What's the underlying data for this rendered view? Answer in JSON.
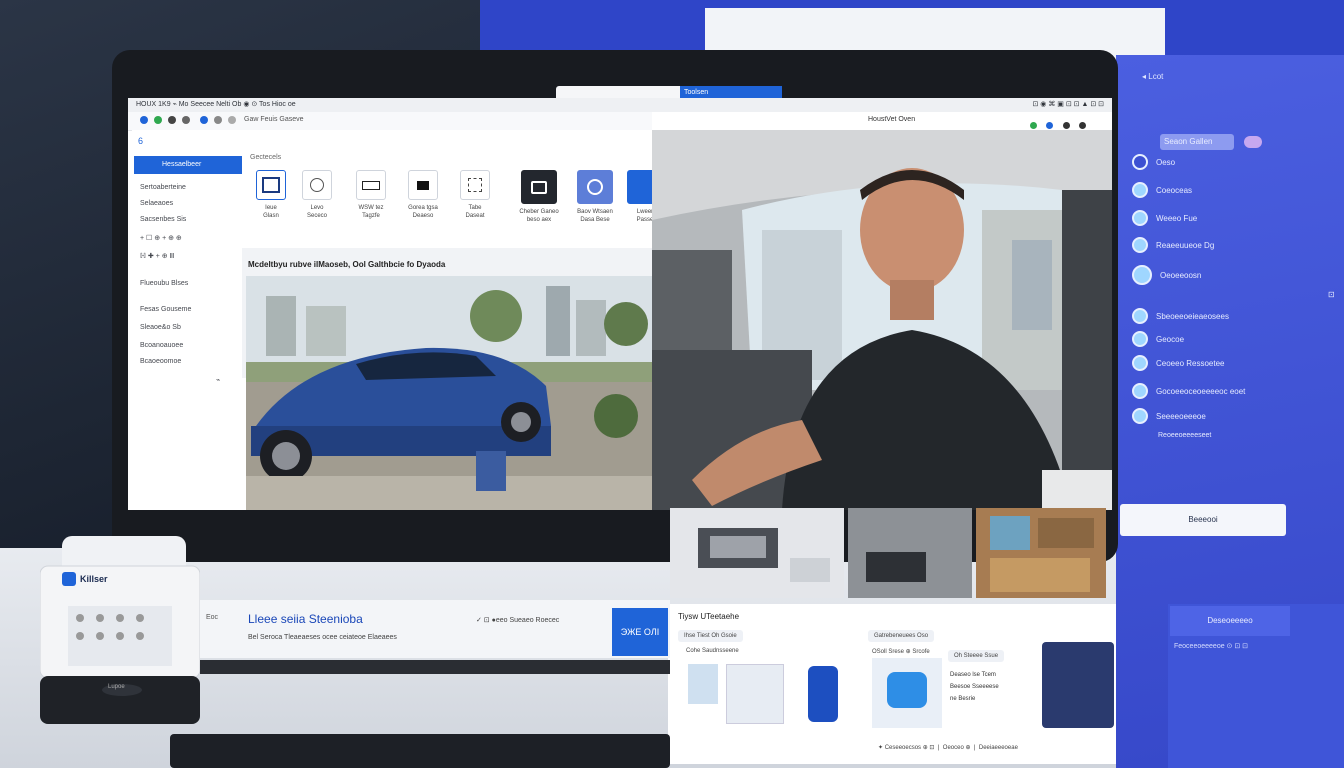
{
  "browser": {
    "menu_left": "HOUX 1K9  ⌁  Mo Seecee Nelti Ob  ◉ ⊙  Tos Hioc oe",
    "menu_right": "⊡ ◉ ⌘ ▣ ⊡ ⊡ ▲ ⊡ ⊡",
    "toolbar_text": "Gaw Feuis Gaseve",
    "active_tab": "Toolsen",
    "video_title": "HoustVet Oven"
  },
  "sidebar": {
    "logo": "6",
    "selected": "Hessaelbeer",
    "items": [
      "Sertoaberteine",
      "Selaeaoes",
      "Sacsenbes Sis",
      "+ ☐ ⊕ + ⊕ ⊕",
      "ℍ ✚ + ⊕ Ⅲ",
      "Flueoubu Blses",
      "Fesas Gouseme",
      "Sleaoe&o Sb",
      "Bcoanoauoee",
      "Bcaoeoomoe"
    ],
    "footer": "⌁"
  },
  "main": {
    "section_label": "Gectecels",
    "tiles": [
      {
        "icon": "frame-icon",
        "label": "Ieue\nGlasn"
      },
      {
        "icon": "clock-icon",
        "label": "Levo\nSececo"
      },
      {
        "icon": "battery-icon",
        "label": "WSW tez\nTagzfe"
      },
      {
        "icon": "screen-icon",
        "label": "Gorea tgsa\nDeaeso"
      },
      {
        "icon": "grid-icon",
        "label": "Tabe\nDaseat"
      },
      {
        "icon": "square-icon",
        "label": "Cheber Ganeo\nbeso aex"
      },
      {
        "icon": "target-icon",
        "label": "Baov Wtsaen\nDasa Bese"
      },
      {
        "icon": "blue-icon",
        "label": "Lweer\nPasse"
      }
    ],
    "heading": "Mcdeltbyu rubve ilMaoseb, Ool Galthbcie fo Dyaoda"
  },
  "bottom_bar": {
    "left": "Eoc",
    "title": "Lleee seiia Steenioba",
    "subtitle": "Bel Seroca Tleaeaeses ocee ceiateoe Elaeaees",
    "right": "✓ ⊡  ●eeo  Sueaeo  Roecec",
    "button": "ЭЖЕ ОЛІ"
  },
  "card": {
    "title": "Tiysw UTeetaehe",
    "pills": [
      "Ihse Tiest Oh Gsoie",
      "Gatrebeneuees Oso",
      "Oh Steeee Ssue"
    ],
    "sub": "Cohe Saudnsseene",
    "side": "OSoll Srese ⊕ Srcofe",
    "lines": [
      "Deaseo lse Tcem",
      "Beesoe Sseeeese",
      "ne Besrie"
    ],
    "footer": "✦ Ceseeoecsos ⊕ ⊡ ❘ Oeoceo ⊕ ❘ Deeiaeeeoeae"
  },
  "right_panel": {
    "back": "◂ Lcot",
    "search": "Seaon Gallen",
    "items": [
      {
        "icon": "circle-icon",
        "label": "Oeso"
      },
      {
        "icon": "camera-icon",
        "label": "Coeoceas"
      },
      {
        "icon": "wifi-icon",
        "label": "Weeeo Fue"
      },
      {
        "icon": "gear-icon",
        "label": "Reaeeuueoe Dg"
      },
      {
        "icon": "globe-icon",
        "label": "Oeoeeoosn"
      },
      {
        "icon": "cloud-icon",
        "label": "Sbeoeeoeieaeosees"
      },
      {
        "icon": "drop-icon",
        "label": "Geocoe"
      },
      {
        "icon": "link-icon",
        "label": "Ceoeeo   Ressoetee"
      },
      {
        "icon": "water-icon",
        "label": "Gocoeeoceoeeeeoc eoet"
      },
      {
        "icon": "lamp-icon",
        "label": "Seeeeoeeeoe"
      }
    ],
    "sub_line": "Reoeeoeeeeseet",
    "side_mark": "⊡",
    "white_button": "Beeeooi",
    "lower_button": "Deseoeeeeo",
    "lower_text": "Feoceeoeeeeoe  ⊙ ⊡ ⊡"
  },
  "device": {
    "brand": "Killser",
    "logo": "Lupoe"
  },
  "colors": {
    "accent": "#1f64d8",
    "panel": "#4257d6"
  }
}
